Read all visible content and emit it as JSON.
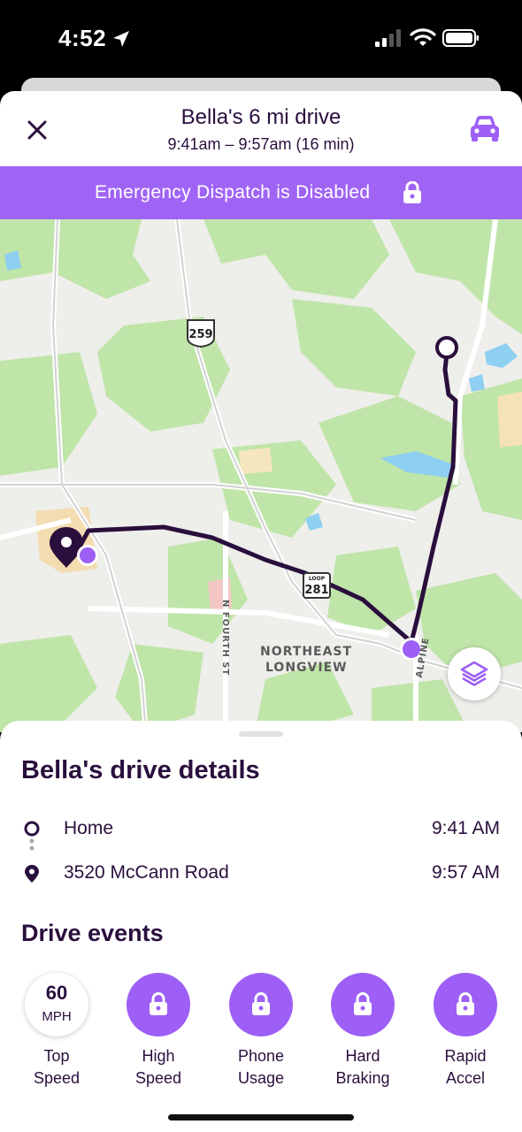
{
  "status_bar": {
    "time": "4:52",
    "location_icon": "location-arrow-icon",
    "signal_icon": "cellular-signal-icon",
    "wifi_icon": "wifi-icon",
    "battery_icon": "battery-icon"
  },
  "header": {
    "title": "Bella's 6 mi drive",
    "subtitle": "9:41am – 9:57am (16 min)",
    "close_icon": "close-icon",
    "car_icon": "car-icon"
  },
  "banner": {
    "text": "Emergency Dispatch is Disabled",
    "icon": "lock-icon",
    "color": "#a064f5"
  },
  "map": {
    "labels": {
      "highway_259": "259",
      "loop_text": "LOOP",
      "loop_number": "281",
      "neighborhood_line1": "NORTHEAST",
      "neighborhood_line2": "LONGVIEW",
      "street_n_fourth": "N FOURTH ST",
      "street_alpine": "ALPINE"
    },
    "route_color": "#2a0f3d",
    "layers_icon": "layers-icon"
  },
  "details": {
    "title": "Bella's drive details",
    "start": {
      "name": "Home",
      "time": "9:41 AM",
      "icon": "origin-circle-icon"
    },
    "end": {
      "name": "3520 McCann Road",
      "time": "9:57 AM",
      "icon": "location-pin-icon"
    }
  },
  "events": {
    "title": "Drive events",
    "items": [
      {
        "label_1": "Top",
        "label_2": "Speed",
        "value": "60",
        "unit": "MPH",
        "locked": false
      },
      {
        "label_1": "High",
        "label_2": "Speed",
        "locked": true,
        "icon": "lock-icon"
      },
      {
        "label_1": "Phone",
        "label_2": "Usage",
        "locked": true,
        "icon": "lock-icon"
      },
      {
        "label_1": "Hard",
        "label_2": "Braking",
        "locked": true,
        "icon": "lock-icon"
      },
      {
        "label_1": "Rapid",
        "label_2": "Accel",
        "locked": true,
        "icon": "lock-icon"
      }
    ]
  },
  "colors": {
    "brand_purple": "#9d5ff5",
    "text_dark": "#2a0f3d"
  }
}
